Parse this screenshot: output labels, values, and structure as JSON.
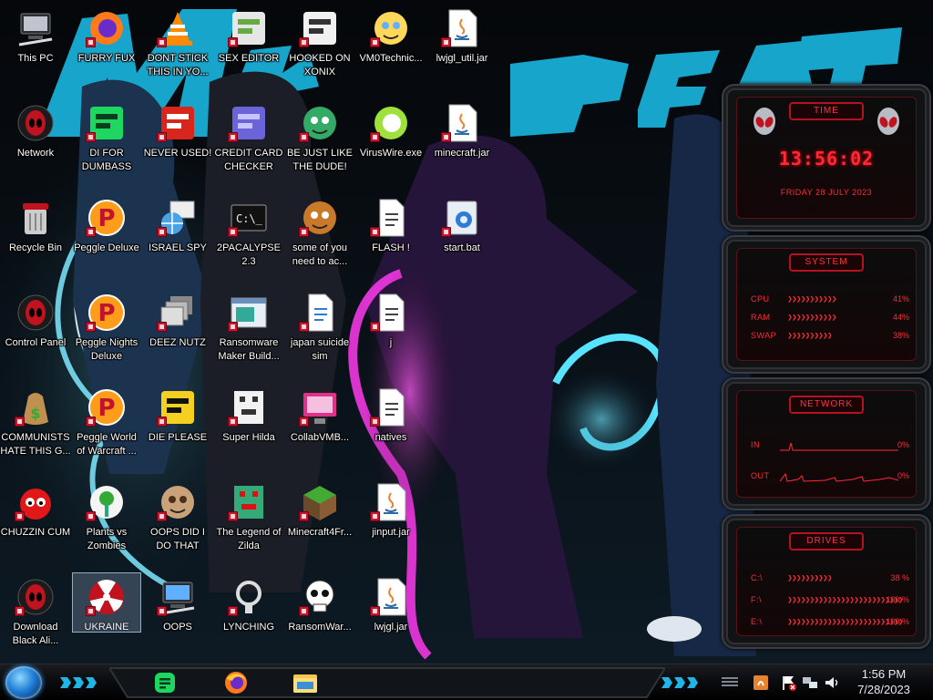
{
  "desktop": {
    "icons": [
      {
        "label": "This PC"
      },
      {
        "label": "FURRY FUX"
      },
      {
        "label": "DONT STICK THIS IN YO..."
      },
      {
        "label": "SEX EDITOR"
      },
      {
        "label": "HOOKED ON XONIX"
      },
      {
        "label": "VM0Technic..."
      },
      {
        "label": "lwjgl_util.jar"
      },
      {
        "label": "Network"
      },
      {
        "label": "DI FOR DUMBASS"
      },
      {
        "label": "NEVER USED!"
      },
      {
        "label": "CREDIT CARD CHECKER"
      },
      {
        "label": "BE JUST LIKE THE DUDE!"
      },
      {
        "label": "VirusWire.exe"
      },
      {
        "label": "minecraft.jar"
      },
      {
        "label": "Recycle Bin"
      },
      {
        "label": "Peggle Deluxe"
      },
      {
        "label": "ISRAEL SPY"
      },
      {
        "label": "2PACALYPSE 2.3"
      },
      {
        "label": "some of you need to ac..."
      },
      {
        "label": "FLASH !"
      },
      {
        "label": "start.bat"
      },
      {
        "label": "Control Panel"
      },
      {
        "label": "Peggle Nights Deluxe"
      },
      {
        "label": "DEEZ NUTZ"
      },
      {
        "label": "Ransomware Maker Build..."
      },
      {
        "label": "japan suicide sim"
      },
      {
        "label": "j"
      },
      {
        "label": "COMMUNISTS HATE THIS G..."
      },
      {
        "label": "Peggle World of Warcraft ..."
      },
      {
        "label": "DIE PLEASE"
      },
      {
        "label": "Super Hilda"
      },
      {
        "label": "CollabVMB..."
      },
      {
        "label": "natives"
      },
      {
        "label": "CHUZZIN CUM"
      },
      {
        "label": "Plants vs Zombies"
      },
      {
        "label": "OOPS DID I DO THAT"
      },
      {
        "label": "The Legend of Zilda"
      },
      {
        "label": "Minecraft4Fr..."
      },
      {
        "label": "jinput.jar"
      },
      {
        "label": "Download Black Ali..."
      },
      {
        "label": "UKRAINE"
      },
      {
        "label": "OOPS"
      },
      {
        "label": "LYNCHING"
      },
      {
        "label": "RansomWar..."
      },
      {
        "label": "lwjgl.jar"
      }
    ]
  },
  "wallpaper": {
    "text": "MrBeast"
  },
  "gadgets": {
    "time": {
      "title": "TIME",
      "clock": "13:56:02",
      "date": "FRIDAY 28 JULY 2023"
    },
    "system": {
      "title": "SYSTEM",
      "rows": [
        {
          "label": "CPU",
          "value": "41%",
          "level": 0.41
        },
        {
          "label": "RAM",
          "value": "44%",
          "level": 0.44
        },
        {
          "label": "SWAP",
          "value": "38%",
          "level": 0.38
        }
      ]
    },
    "network": {
      "title": "NETWORK",
      "rows": [
        {
          "label": "IN",
          "value": "0%"
        },
        {
          "label": "OUT",
          "value": "0%"
        }
      ]
    },
    "drives": {
      "title": "DRIVES",
      "rows": [
        {
          "label": "C:\\",
          "value": "38 %",
          "level": 0.38
        },
        {
          "label": "F:\\",
          "value": "100 %",
          "level": 1.0
        },
        {
          "label": "E:\\",
          "value": "100 %",
          "level": 1.0
        }
      ]
    }
  },
  "taskbar": {
    "pinned": [
      {
        "name": "spotify-like-app"
      },
      {
        "name": "firefox"
      },
      {
        "name": "file-explorer"
      }
    ],
    "clock": {
      "time": "1:56 PM",
      "date": "7/28/2023"
    }
  },
  "colors": {
    "gadget_red": "#ff2a36",
    "accent_cyan": "#27c2ec",
    "accent_magenta": "#d624c8"
  }
}
